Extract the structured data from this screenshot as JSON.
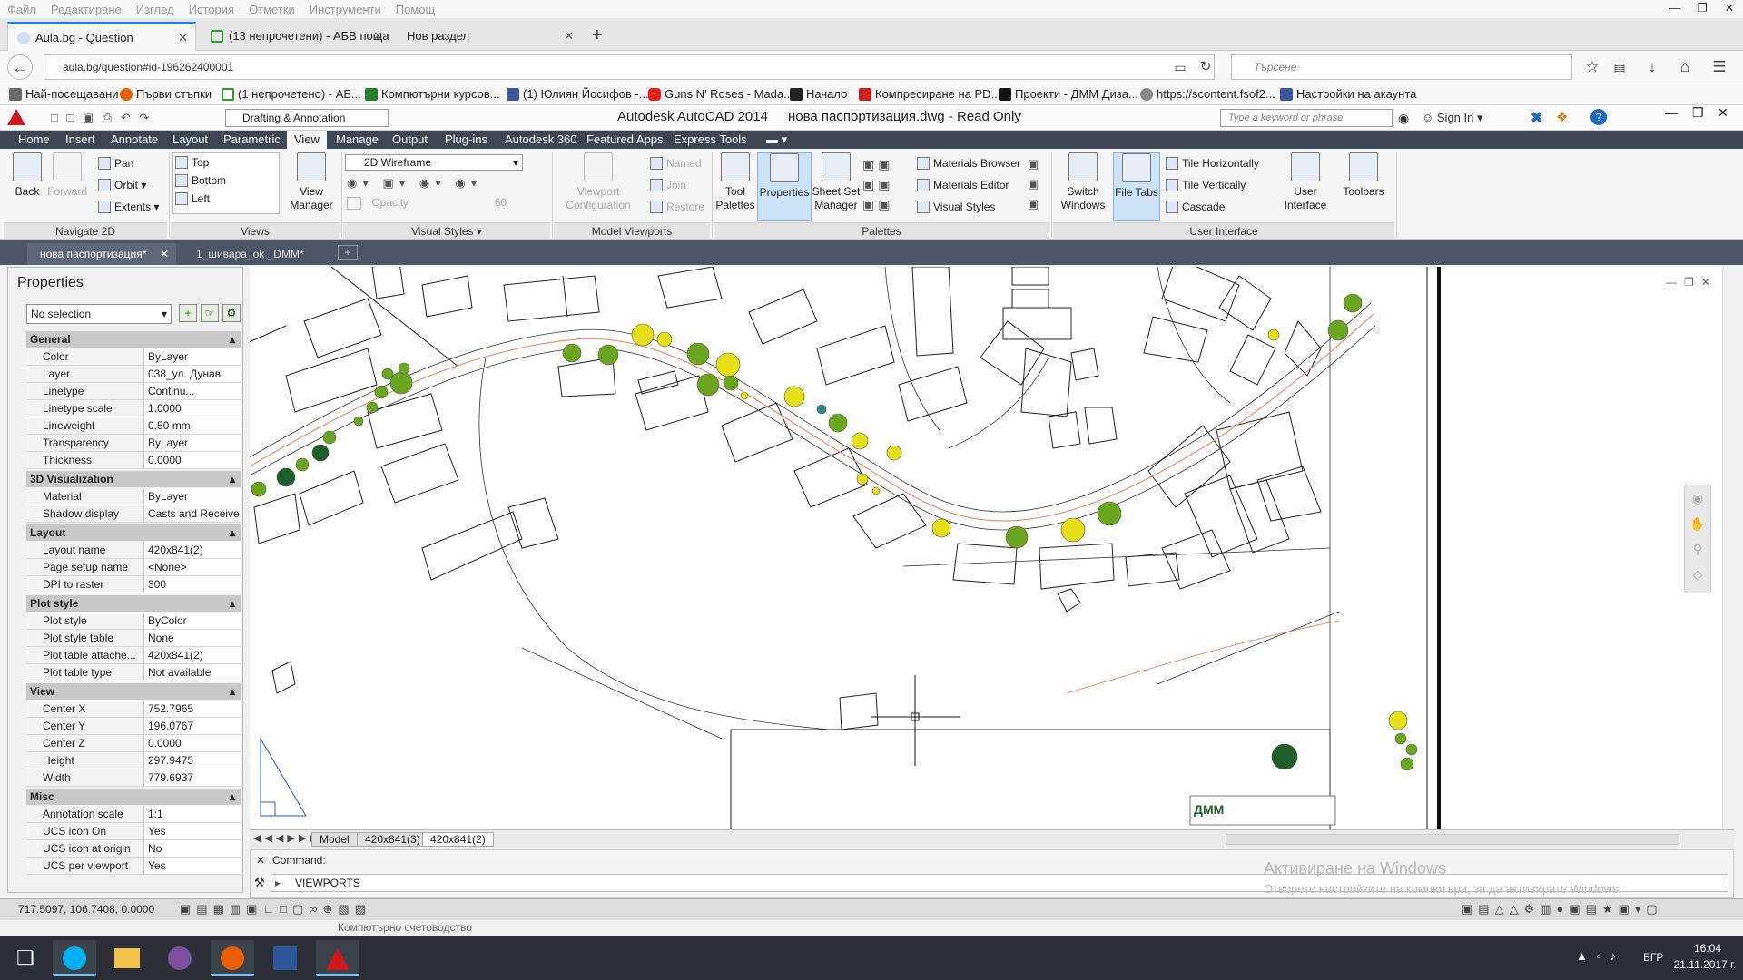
{
  "firefox": {
    "menu": [
      "Файл",
      "Редактиране",
      "Изглед",
      "История",
      "Отметки",
      "Инструменти",
      "Помощ"
    ],
    "tabs": [
      {
        "label": "Aula.bg - Question",
        "active": true
      },
      {
        "label": "(13 непрочетени) - АБВ поща",
        "active": false
      },
      {
        "label": "Нов раздел",
        "active": false
      }
    ],
    "new_tab": "+",
    "url": "aula.bg/question#id-196262400001",
    "search_placeholder": "Търсене",
    "bookmarks": [
      {
        "label": "Най-посещавани",
        "color": "#6b6b6b"
      },
      {
        "label": "Първи стъпки",
        "color": "#e66000"
      },
      {
        "label": "(1 непрочетено) - АБ...",
        "color": "#2f9a2f"
      },
      {
        "label": "Компютърни курсов...",
        "color": "#2a7d2a"
      },
      {
        "label": "(1) Юлиян Йосифов -...",
        "color": "#3b5998"
      },
      {
        "label": "Guns N' Roses - Mada...",
        "color": "#e62117"
      },
      {
        "label": "Начало",
        "color": "#222222"
      },
      {
        "label": "Компресиране на PD...",
        "color": "#d02020"
      },
      {
        "label": "Проекти - ДММ Диза...",
        "color": "#111111"
      },
      {
        "label": "https://scontent.fsof2...",
        "color": "#888888"
      },
      {
        "label": "Настройки на акаунта",
        "color": "#3b5998"
      }
    ]
  },
  "acad": {
    "workspace": "Drafting & Annotation",
    "title": "Autodesk AutoCAD 2014",
    "file_title": "нова паспортизация.dwg - Read Only",
    "search_placeholder": "Type a keyword or phrase",
    "sign_in": "Sign In",
    "menu_tabs": [
      "Home",
      "Insert",
      "Annotate",
      "Layout",
      "Parametric",
      "View",
      "Manage",
      "Output",
      "Plug-ins",
      "Autodesk 360",
      "Featured Apps",
      "Express Tools"
    ],
    "active_menu_tab": "View",
    "ribbon": {
      "navigate": {
        "title": "Navigate 2D",
        "back": "Back",
        "forward": "Forward",
        "pan": "Pan",
        "orbit": "Orbit",
        "extents": "Extents"
      },
      "views": {
        "title": "Views",
        "items": [
          "Top",
          "Bottom",
          "Left"
        ],
        "manager": "View Manager"
      },
      "visual_styles": {
        "title": "Visual Styles",
        "current": "2D Wireframe",
        "opacity": "Opacity",
        "opacity_value": "60"
      },
      "model_viewports": {
        "title": "Model Viewports",
        "config": "Viewport Configuration",
        "named": "Named",
        "join": "Join",
        "restore": "Restore"
      },
      "palettes": {
        "title": "Palettes",
        "tool": "Tool Palettes",
        "properties": "Properties",
        "sheet_set": "Sheet Set Manager",
        "mat_browser": "Materials Browser",
        "mat_editor": "Materials Editor",
        "visual_styles": "Visual Styles"
      },
      "ui": {
        "title": "User Interface",
        "switch": "Switch Windows",
        "file_tabs": "File Tabs",
        "tile_h": "Tile Horizontally",
        "tile_v": "Tile Vertically",
        "cascade": "Cascade",
        "user_interface": "User Interface",
        "toolbars": "Toolbars"
      }
    },
    "doc_tabs": [
      {
        "label": "нова паспортизация*",
        "active": true
      },
      {
        "label": "1_шивара_ok _DMM*",
        "active": false
      }
    ],
    "properties": {
      "title": "Properties",
      "selection": "No selection",
      "sections": [
        {
          "name": "General",
          "rows": [
            {
              "k": "Color",
              "v": "ByLayer"
            },
            {
              "k": "Layer",
              "v": "038_ул. Дунав"
            },
            {
              "k": "Linetype",
              "v": "Continu..."
            },
            {
              "k": "Linetype scale",
              "v": "1.0000"
            },
            {
              "k": "Lineweight",
              "v": "0.50 mm"
            },
            {
              "k": "Transparency",
              "v": "ByLayer"
            },
            {
              "k": "Thickness",
              "v": "0.0000"
            }
          ]
        },
        {
          "name": "3D Visualization",
          "rows": [
            {
              "k": "Material",
              "v": "ByLayer"
            },
            {
              "k": "Shadow display",
              "v": "Casts and Receive..."
            }
          ]
        },
        {
          "name": "Layout",
          "rows": [
            {
              "k": "Layout name",
              "v": "420x841(2)"
            },
            {
              "k": "Page setup name",
              "v": "<None>"
            },
            {
              "k": "DPI to raster",
              "v": "300"
            }
          ]
        },
        {
          "name": "Plot style",
          "rows": [
            {
              "k": "Plot style",
              "v": "ByColor"
            },
            {
              "k": "Plot style table",
              "v": "None"
            },
            {
              "k": "Plot table attache...",
              "v": "420x841(2)"
            },
            {
              "k": "Plot table type",
              "v": "Not available"
            }
          ]
        },
        {
          "name": "View",
          "rows": [
            {
              "k": "Center X",
              "v": "752.7965"
            },
            {
              "k": "Center Y",
              "v": "196.0767"
            },
            {
              "k": "Center Z",
              "v": "0.0000"
            },
            {
              "k": "Height",
              "v": "297.9475"
            },
            {
              "k": "Width",
              "v": "779.6937"
            }
          ]
        },
        {
          "name": "Misc",
          "rows": [
            {
              "k": "Annotation scale",
              "v": "1:1"
            },
            {
              "k": "UCS icon On",
              "v": "Yes"
            },
            {
              "k": "UCS icon at origin",
              "v": "No"
            },
            {
              "k": "UCS per viewport",
              "v": "Yes"
            }
          ]
        }
      ]
    },
    "layout_tabs": [
      "Model",
      "420x841(3)",
      "420x841(2)"
    ],
    "active_layout": "420x841(2)",
    "command_label": "Command:",
    "command_history": "VIEWPORTS",
    "coords": "717.5097, 106.7408, 0.0000",
    "tooltip_strip": "Компютърно счетоводство",
    "watermark_title": "Активиране на Windows",
    "watermark_text": "Отворете настройките на компютъра, за да активирате Windows.",
    "title_block_text": "ДММ"
  },
  "taskbar": {
    "lang": "БГР",
    "time": "16:04",
    "date": "21.11.2017 г."
  },
  "colors": {
    "tree_yellow": "#e6e01a",
    "tree_green": "#6ba61f",
    "tree_dark": "#1e5e2a",
    "road_line": "#e8906b",
    "accent": "#0a84ff"
  }
}
